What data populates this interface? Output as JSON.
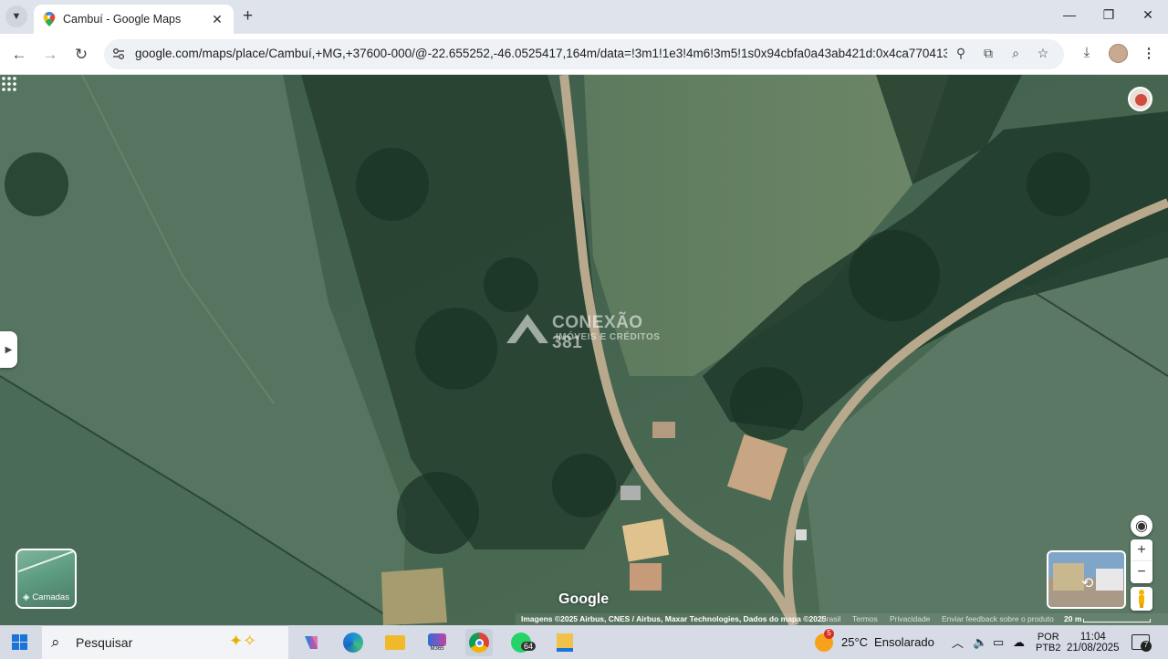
{
  "browser": {
    "tab_title": "Cambuí - Google Maps",
    "url": "google.com/maps/place/Cambuí,+MG,+37600-000/@-22.655252,-46.0525417,164m/data=!3m1!1e3!4m6!3m5!1s0x94cbfa0a43ab421d:0x4ca7704131a..."
  },
  "map": {
    "watermark_line1": "CONEXÃO 381",
    "watermark_line2": "IMÓVEIS E CRÉDITOS",
    "layers_label": "Camadas",
    "google_logo": "Google",
    "footer": {
      "imagery": "Imagens ©2025 Airbus, CNES / Airbus, Maxar Technologies, Dados do mapa ©2025",
      "country": "Brasil",
      "terms": "Termos",
      "privacy": "Privacidade",
      "feedback": "Enviar feedback sobre o produto",
      "scale": "20 m"
    }
  },
  "taskbar": {
    "search_placeholder": "Pesquisar",
    "whatsapp_badge": "64",
    "weather_badge": "5",
    "weather_temp": "25°C",
    "weather_desc": "Ensolarado",
    "lang_line1": "POR",
    "lang_line2": "PTB2",
    "time": "11:04",
    "date": "21/08/2025",
    "notif_count": "7",
    "m365_label": "M365"
  }
}
